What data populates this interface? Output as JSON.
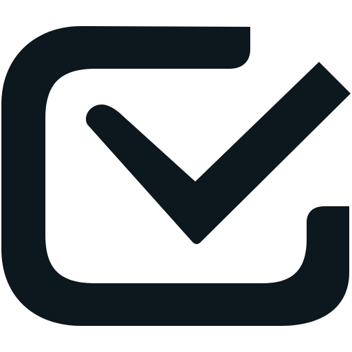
{
  "icon": {
    "name": "checkbox-checked-icon",
    "color": "#0c171e",
    "background": "#ffffff"
  }
}
